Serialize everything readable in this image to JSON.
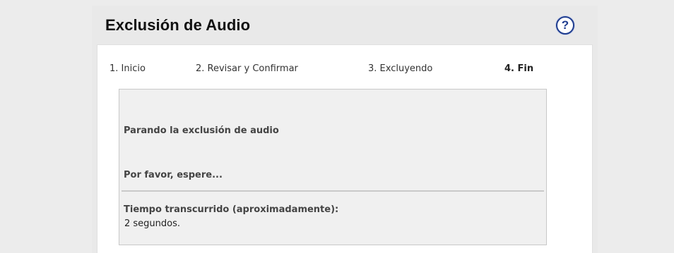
{
  "dialog": {
    "title": "Exclusión de Audio",
    "help_icon": "question-circle-icon",
    "help_glyph": "?"
  },
  "steps": [
    {
      "label": "1. Inicio",
      "active": false
    },
    {
      "label": "2. Revisar y Confirmar",
      "active": false
    },
    {
      "label": "3. Excluyendo",
      "active": false
    },
    {
      "label": "4. Fin",
      "active": true
    }
  ],
  "panel": {
    "status": "Parando la exclusión de audio",
    "wait": "Por favor, espere...",
    "elapsed_label": "Tiempo transcurrido (aproximadamente):",
    "elapsed_value": "2 segundos."
  },
  "colors": {
    "help_icon": "#1f3d8f",
    "panel_background": "#f0f0f0",
    "page_background": "#ececec"
  }
}
